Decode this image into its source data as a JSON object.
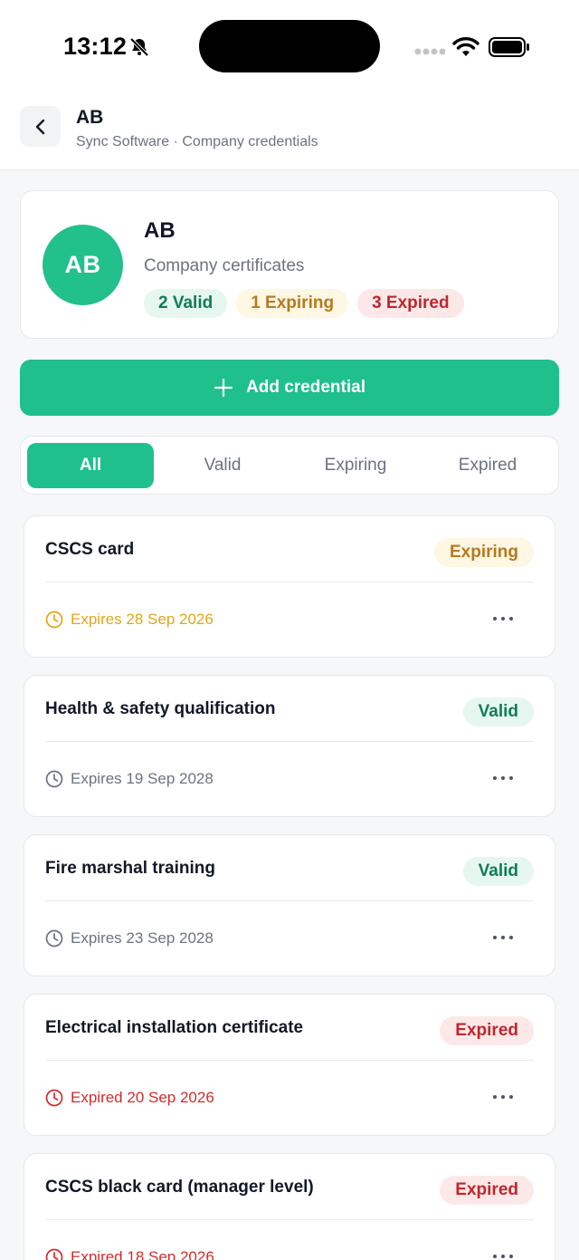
{
  "status_bar": {
    "time": "13:12"
  },
  "header": {
    "title": "AB",
    "subtitle": "Sync Software · Company credentials"
  },
  "profile": {
    "initials": "AB",
    "name": "AB",
    "subtitle": "Company certificates",
    "counts": {
      "valid": "2 Valid",
      "expiring": "1 Expiring",
      "expired": "3 Expired"
    }
  },
  "add_button": {
    "label": "Add credential"
  },
  "tabs": [
    {
      "label": "All",
      "active": true
    },
    {
      "label": "Valid",
      "active": false
    },
    {
      "label": "Expiring",
      "active": false
    },
    {
      "label": "Expired",
      "active": false
    }
  ],
  "credentials": [
    {
      "title": "CSCS card",
      "status": "Expiring",
      "status_key": "expiring",
      "expiry": "Expires 28 Sep 2026"
    },
    {
      "title": "Health & safety qualification",
      "status": "Valid",
      "status_key": "valid",
      "expiry": "Expires 19 Sep 2028"
    },
    {
      "title": "Fire marshal training",
      "status": "Valid",
      "status_key": "valid",
      "expiry": "Expires 23 Sep 2028"
    },
    {
      "title": "Electrical installation certificate",
      "status": "Expired",
      "status_key": "expired",
      "expiry": "Expired 20 Sep 2026"
    },
    {
      "title": "CSCS black card (manager level)",
      "status": "Expired",
      "status_key": "expired",
      "expiry": "Expired 18 Sep 2026"
    }
  ],
  "colors": {
    "accent": "#1fc08b",
    "valid": "#0f7d55",
    "expiring": "#b7791f",
    "expired": "#c0262d"
  }
}
